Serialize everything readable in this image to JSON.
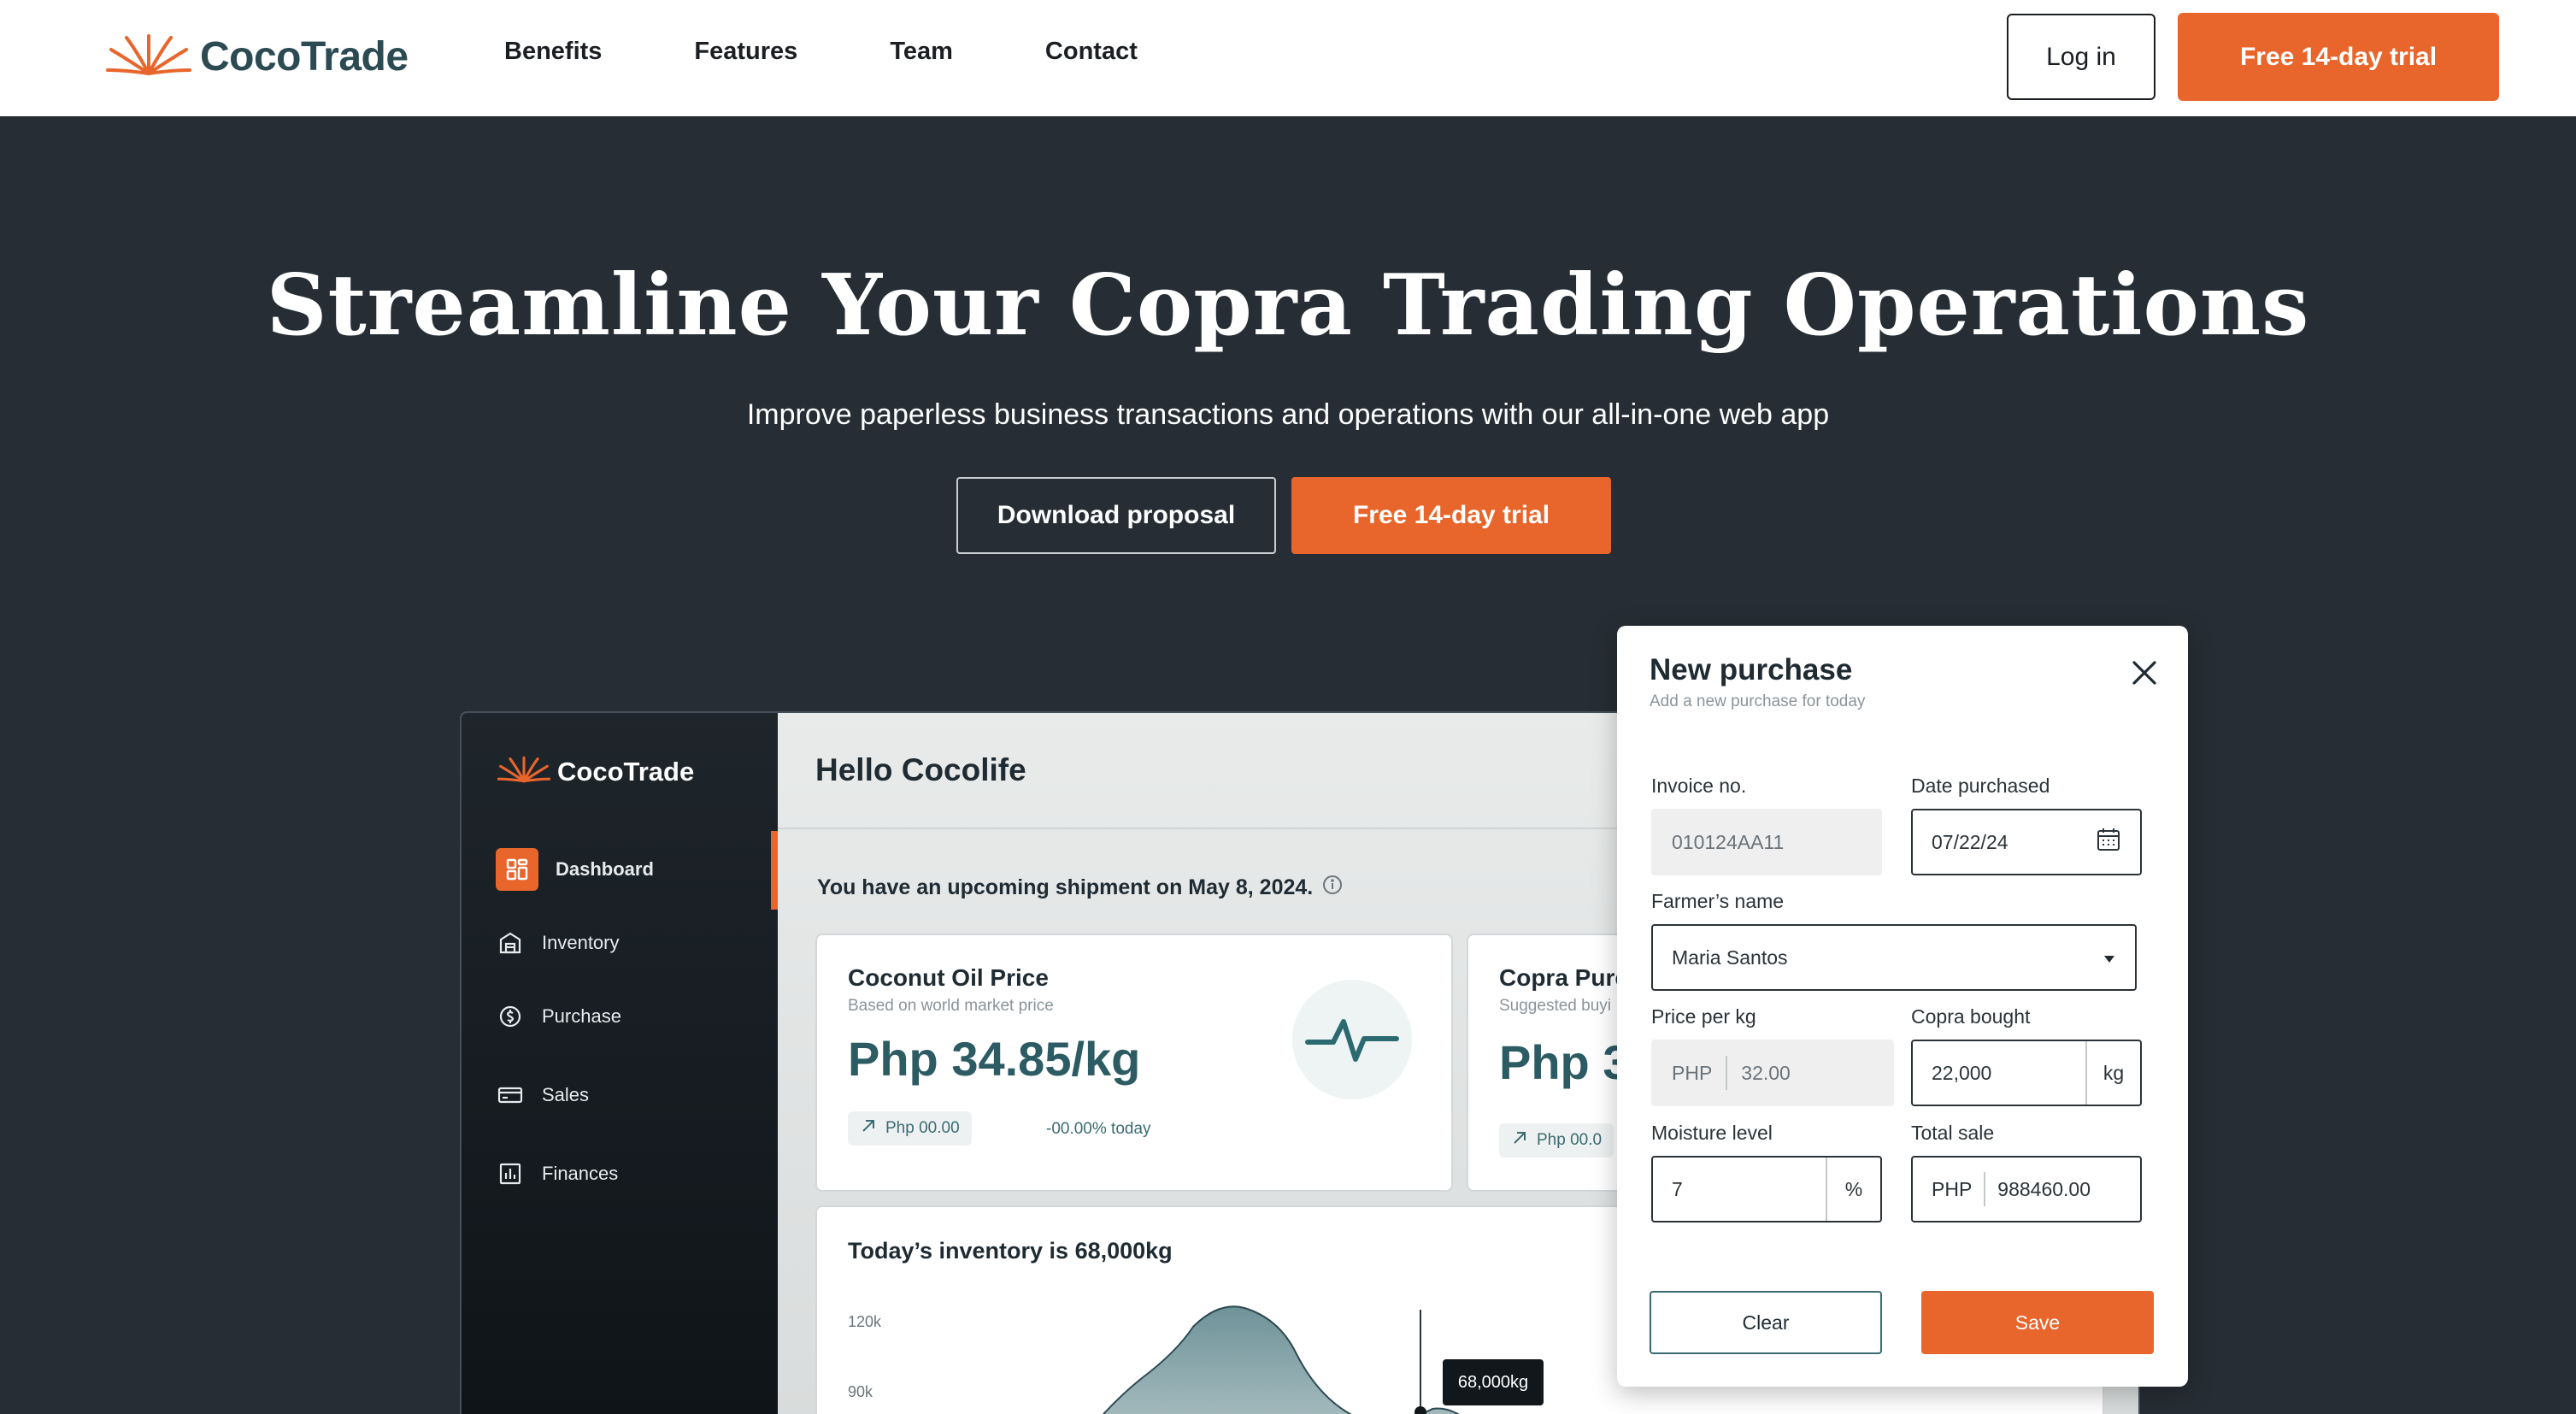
{
  "brand": {
    "name": "CocoTrade",
    "accent": "#e8652c",
    "dark": "#262d34"
  },
  "nav": {
    "links": [
      "Benefits",
      "Features",
      "Team",
      "Contact"
    ],
    "login_label": "Log in",
    "trial_label": "Free 14-day trial"
  },
  "hero": {
    "title": "Streamline Your Copra Trading Operations",
    "subtitle": "Improve paperless business transactions and operations with our all-in-one web app",
    "download_label": "Download proposal",
    "trial_label": "Free 14-day trial"
  },
  "app": {
    "brand": "CocoTrade",
    "sidebar": [
      {
        "label": "Dashboard",
        "icon": "dashboard-icon",
        "active": true
      },
      {
        "label": "Inventory",
        "icon": "warehouse-icon",
        "active": false
      },
      {
        "label": "Purchase",
        "icon": "coin-icon",
        "active": false
      },
      {
        "label": "Sales",
        "icon": "cash-icon",
        "active": false
      },
      {
        "label": "Finances",
        "icon": "bar-chart-icon",
        "active": false
      }
    ],
    "greeting": "Hello Cocolife",
    "notice": "You have an upcoming shipment on May 8, 2024.",
    "oil_card": {
      "title": "Coconut Oil Price",
      "subtitle": "Based on world market price",
      "value": "Php 34.85/kg",
      "change": "Php 00.00",
      "pct": "-00.00% today"
    },
    "copra_card": {
      "title": "Copra Purc",
      "subtitle": "Suggested buyi",
      "value": "Php 3",
      "change": "Php 00.0"
    },
    "inventory": {
      "title": "Today’s inventory is 68,000kg",
      "y_labels": [
        "120k",
        "90k"
      ],
      "tooltip": "68,000kg"
    }
  },
  "modal": {
    "title": "New purchase",
    "subtitle": "Add a new purchase for today",
    "invoice_label": "Invoice no.",
    "invoice_value": "010124AA11",
    "date_label": "Date purchased",
    "date_value": "07/22/24",
    "farmer_label": "Farmer’s name",
    "farmer_value": "Maria Santos",
    "price_label": "Price per kg",
    "price_prefix": "PHP",
    "price_value": "32.00",
    "copra_label": "Copra bought",
    "copra_value": "22,000",
    "copra_unit": "kg",
    "moisture_label": "Moisture level",
    "moisture_value": "7",
    "moisture_unit": "%",
    "total_label": "Total sale",
    "total_prefix": "PHP",
    "total_value": "988460.00",
    "clear_label": "Clear",
    "save_label": "Save"
  }
}
